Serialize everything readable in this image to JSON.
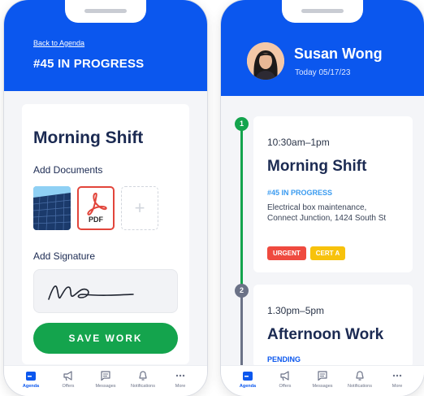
{
  "left_screen": {
    "back_link": "Back to Agenda",
    "job_title": "#45 IN PROGRESS",
    "shift_title": "Morning Shift",
    "documents_label": "Add Documents",
    "pdf_label": "PDF",
    "add_doc_symbol": "+",
    "signature_label": "Add Signature",
    "save_button": "SAVE WORK"
  },
  "right_screen": {
    "user_name": "Susan Wong",
    "date": "Today 05/17/23",
    "events": [
      {
        "index": "1",
        "time": "10:30am–1pm",
        "title": "Morning Shift",
        "status": "#45 IN PROGRESS",
        "address": "Electrical box maintenance, Connect Junction, 1424 South St",
        "tags": [
          "URGENT",
          "CERT A"
        ]
      },
      {
        "index": "2",
        "time": "1.30pm–5pm",
        "title": "Afternoon Work",
        "status": "PENDING"
      }
    ]
  },
  "bottom_nav": {
    "items": [
      {
        "label": "Agenda",
        "icon": "calendar-icon"
      },
      {
        "label": "Offers",
        "icon": "megaphone-icon"
      },
      {
        "label": "Messages",
        "icon": "chat-icon"
      },
      {
        "label": "Notifications",
        "icon": "bell-icon"
      },
      {
        "label": "More",
        "icon": "more-icon"
      }
    ],
    "active": "Agenda"
  },
  "colors": {
    "brand_blue": "#0b57ee",
    "save_green": "#14a44d",
    "navy_text": "#1b2a52",
    "status_blue": "#3a9bf0",
    "urgent_red": "#ef4a3f",
    "cert_yellow": "#f7c20c",
    "pdf_red": "#e2453b",
    "pending_gray": "#6b7287"
  }
}
